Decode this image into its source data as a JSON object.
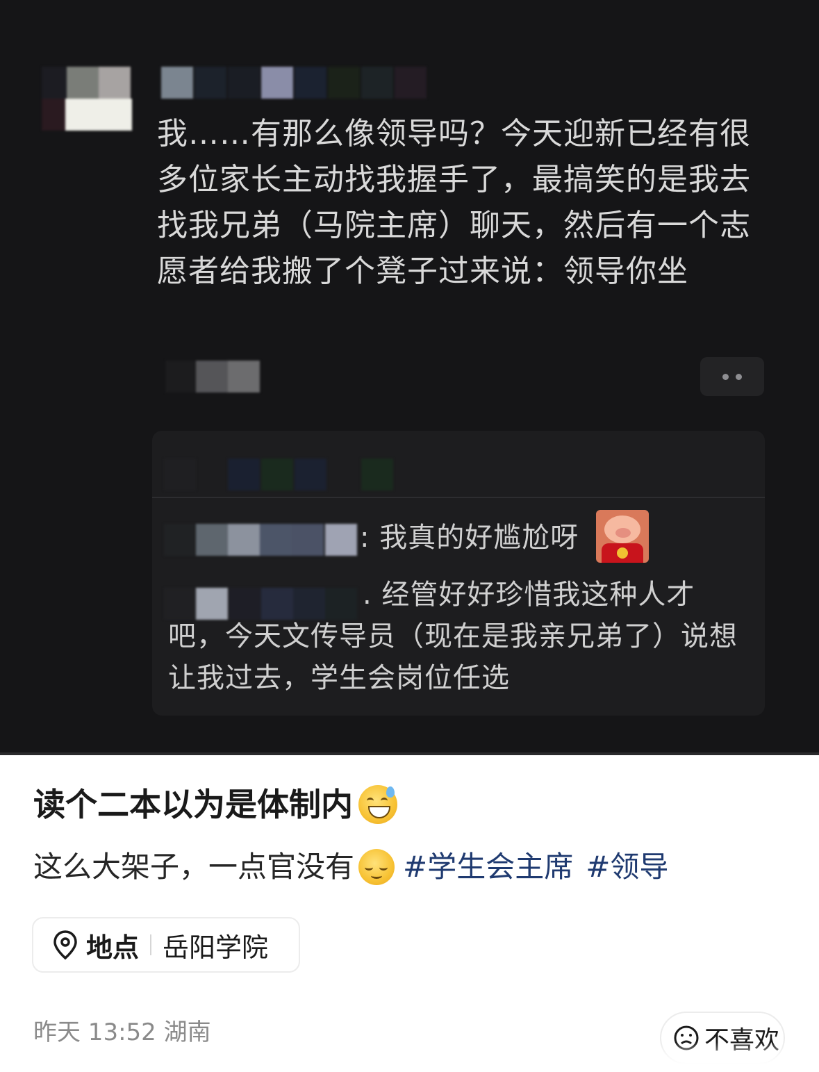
{
  "screenshot": {
    "post_text": "我……有那么像领导吗？今天迎新已经有很多位家长主动找我握手了，最搞笑的是我去找我兄弟（马院主席）聊天，然后有一个志愿者给我搬了个凳子过来说：领导你坐",
    "comment_1_text": ": 我真的好尴尬呀",
    "comment_2_text": ". 经管好好珍惜我这种人才吧，今天文传导员（现在是我亲兄弟了）说想让我过去，学生会岗位任选",
    "pig_sticker_icon": "pig-sticker-icon",
    "more_icon": "more-dots-icon"
  },
  "post": {
    "title": "读个二本以为是体制内",
    "title_emoji": "sweat-smile-emoji",
    "description": "这么大架子，一点官没有",
    "description_emoji": "relieved-face-emoji",
    "tags": [
      "#学生会主席",
      "#领导"
    ],
    "tag_color": "#1f3a70"
  },
  "location": {
    "label": "地点",
    "value": "岳阳学院",
    "icon": "map-pin-icon"
  },
  "meta": {
    "time_region": "昨天 13:52 湖南"
  },
  "dislike": {
    "label": "不喜欢",
    "icon": "frown-face-icon"
  }
}
